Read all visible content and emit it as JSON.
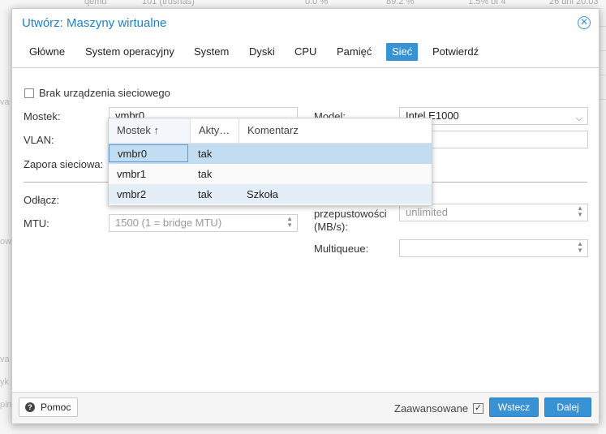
{
  "background": {
    "top_row": [
      "qemu",
      "101 (trusnas)",
      "0.0 %",
      "89.2 %",
      "1.5% of 4",
      "26 dni 20:03"
    ],
    "left_fragments": [
      "va",
      "ow",
      "va",
      "yk",
      "pin"
    ]
  },
  "dialog": {
    "title": "Utwórz: Maszyny wirtualne",
    "close_icon": "close-circle-icon",
    "accent_color": "#3892d4",
    "tabs": [
      "Główne",
      "System operacyjny",
      "System",
      "Dyski",
      "CPU",
      "Pamięć",
      "Sieć",
      "Potwierdź"
    ],
    "active_tab": "Sieć"
  },
  "form": {
    "no_network_label": "Brak urządzenia sieciowego",
    "no_network_checked": false,
    "bridge_label": "Mostek:",
    "bridge_value": "vmbr0",
    "vlan_label": "VLAN:",
    "firewall_label": "Zapora sieciowa:",
    "disconnect_label": "Odłącz:",
    "mtu_label": "MTU:",
    "mtu_value": "1500 (1 = bridge MTU)",
    "model_label": "Model:",
    "model_value": "Intel E1000",
    "bandwidth_label": "przepustowości (MB/s):",
    "bandwidth_value": "unlimited",
    "multiqueue_label": "Multiqueue:",
    "multiqueue_value": ""
  },
  "bridge_dropdown": {
    "columns": [
      "Mostek ↑",
      "Akty…",
      "Komentarz"
    ],
    "rows": [
      {
        "name": "vmbr0",
        "active": "tak",
        "comment": ""
      },
      {
        "name": "vmbr1",
        "active": "tak",
        "comment": ""
      },
      {
        "name": "vmbr2",
        "active": "tak",
        "comment": "Szkoła"
      }
    ],
    "selected_row": 0,
    "hovered_row": 2
  },
  "footer": {
    "help_label": "Pomoc",
    "help_icon": "question-circle-icon",
    "advanced_label": "Zaawansowane",
    "advanced_checked": true,
    "back_label": "Wstecz",
    "next_label": "Dalej"
  }
}
